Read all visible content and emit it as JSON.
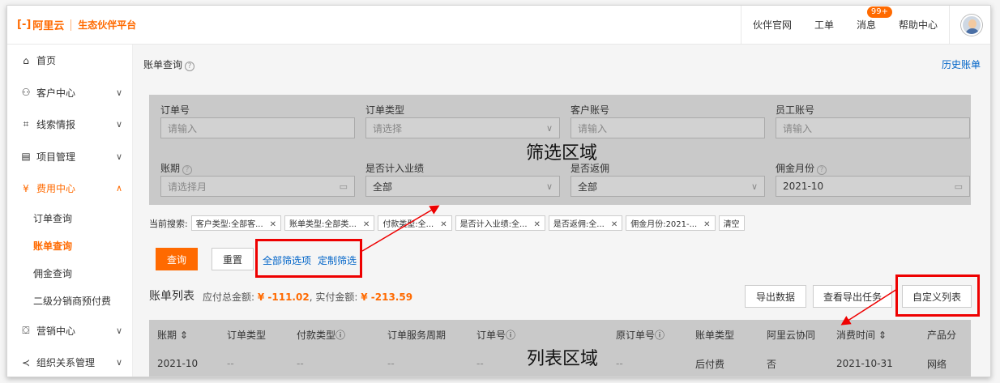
{
  "header": {
    "logo_mark": "[-]",
    "logo_text": "阿里云",
    "sub_title": "生态伙伴平台",
    "nav": [
      "伙伴官网",
      "工单",
      "消息",
      "帮助中心"
    ],
    "badge": "99+"
  },
  "sidebar": {
    "items": [
      {
        "label": "首页",
        "icon": "home-icon",
        "glyph": "⌂",
        "chev": ""
      },
      {
        "label": "客户中心",
        "icon": "customer-icon",
        "glyph": "⚇",
        "chev": "∨"
      },
      {
        "label": "线索情报",
        "icon": "leads-icon",
        "glyph": "⌗",
        "chev": "∨"
      },
      {
        "label": "项目管理",
        "icon": "project-icon",
        "glyph": "▤",
        "chev": "∨"
      },
      {
        "label": "费用中心",
        "icon": "fee-icon",
        "glyph": "¥",
        "chev": "∧"
      }
    ],
    "sub_items": [
      "订单查询",
      "账单查询",
      "佣金查询",
      "二级分销商预付费"
    ],
    "bottom_items": [
      {
        "label": "营销中心",
        "icon": "marketing-icon",
        "glyph": "⛋",
        "chev": "∨"
      },
      {
        "label": "组织关系管理",
        "icon": "org-icon",
        "glyph": "≺",
        "chev": "∨"
      }
    ]
  },
  "main": {
    "breadcrumb": "账单查询",
    "history_link": "历史账单",
    "filter": {
      "row1": [
        {
          "label": "订单号",
          "placeholder": "请输入",
          "tail": ""
        },
        {
          "label": "订单类型",
          "placeholder": "请选择",
          "tail": "∨"
        },
        {
          "label": "客户账号",
          "placeholder": "请输入",
          "tail": ""
        },
        {
          "label": "员工账号",
          "placeholder": "请输入",
          "tail": ""
        }
      ],
      "row2": [
        {
          "label": "账期",
          "placeholder": "请选择月",
          "tail": "▭"
        },
        {
          "label": "是否计入业绩",
          "placeholder": "全部",
          "tail": "∨"
        },
        {
          "label": "是否返佣",
          "placeholder": "全部",
          "tail": "∨"
        },
        {
          "label": "佣金月份",
          "placeholder": "2021-10",
          "tail": "▭"
        }
      ],
      "overlay": "筛选区域"
    },
    "current_search_label": "当前搜索:",
    "tags": [
      "客户类型:全部客...",
      "账单类型:全部类...",
      "付款类型:全...",
      "是否计入业绩:全...",
      "是否返佣:全...",
      "佣金月份:2021-..."
    ],
    "clear": "清空",
    "buttons": {
      "query": "查询",
      "reset": "重置",
      "all_filters": "全部筛选项",
      "custom_filter": "定制筛选",
      "export": "导出数据",
      "view_export": "查看导出任务",
      "custom_columns": "自定义列表"
    },
    "list_title": "账单列表",
    "sum_label1": "应付总金额:",
    "sum_val1": "¥ -111.02",
    "sum_sep": ",",
    "sum_label2": "实付金额:",
    "sum_val2": "¥ -213.59",
    "table": {
      "headers": [
        "账期 ⇕",
        "订单类型",
        "付款类型ⓘ",
        "订单服务周期",
        "订单号ⓘ",
        "原订单号ⓘ",
        "账单类型",
        "阿里云协同",
        "消费时间 ⇕",
        "产品分"
      ],
      "row": [
        "2021-10",
        "--",
        "--",
        "--",
        "--",
        "--",
        "后付费",
        "否",
        "2021-10-31",
        "网络"
      ],
      "overlay": "列表区域"
    }
  }
}
